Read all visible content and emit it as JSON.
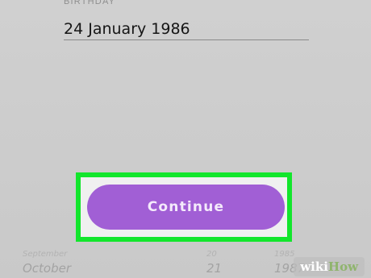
{
  "birthday": {
    "label": "BIRTHDAY",
    "value": "24 January 1986"
  },
  "continue_button": {
    "label": "Continue",
    "color": "#a15fd5"
  },
  "highlight": {
    "color": "#12e62c"
  },
  "date_picker": {
    "month_prev": "September",
    "month": "October",
    "day_prev": "20",
    "day": "21",
    "year_prev": "1985",
    "year": "1987"
  },
  "watermark": {
    "wiki": "wiki",
    "how": "How"
  }
}
